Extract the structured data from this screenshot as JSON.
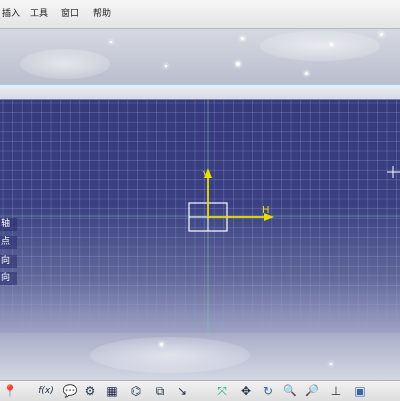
{
  "menu": {
    "items": [
      {
        "label": "插入"
      },
      {
        "label": "工具"
      },
      {
        "label": "窗口"
      },
      {
        "label": "帮助"
      }
    ]
  },
  "viewport": {
    "axes": {
      "vertical_label": "V",
      "horizontal_label": "H"
    },
    "side_labels": [
      "轴",
      "点",
      "向",
      "向"
    ],
    "accent_color": "#e6e000",
    "background_color": "#353a7c"
  },
  "toolbar": {
    "icons": [
      {
        "name": "pin-icon",
        "glyph": "📍"
      },
      {
        "name": "formula-icon",
        "glyph": "f(x)"
      },
      {
        "name": "knowledge-icon",
        "glyph": "💬"
      },
      {
        "name": "gear-icon",
        "glyph": "⚙"
      },
      {
        "name": "table-icon",
        "glyph": "▦"
      },
      {
        "name": "tree-icon",
        "glyph": "⌬"
      },
      {
        "name": "constraint-icon",
        "glyph": "⧉"
      },
      {
        "name": "swap-icon",
        "glyph": "↘"
      },
      {
        "name": "fit-all-icon",
        "glyph": "⤧"
      },
      {
        "name": "pan-icon",
        "glyph": "✥"
      },
      {
        "name": "rotate-icon",
        "glyph": "↻"
      },
      {
        "name": "zoom-in-icon",
        "glyph": "🔍"
      },
      {
        "name": "zoom-out-icon",
        "glyph": "🔎"
      },
      {
        "name": "normal-view-icon",
        "glyph": "⊥"
      },
      {
        "name": "view-icon",
        "glyph": "▣"
      }
    ]
  }
}
